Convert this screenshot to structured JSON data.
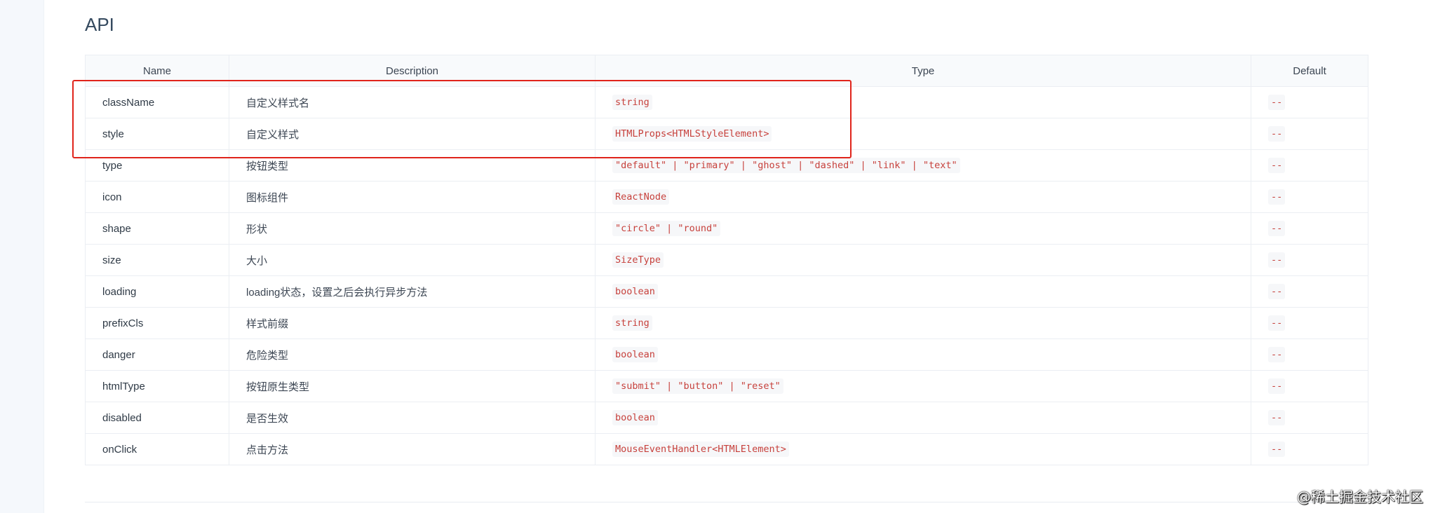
{
  "section": {
    "title": "API"
  },
  "table": {
    "headers": {
      "name": "Name",
      "description": "Description",
      "type": "Type",
      "default": "Default"
    },
    "rows": [
      {
        "name": "className",
        "description": "自定义样式名",
        "type": "string",
        "default": "--"
      },
      {
        "name": "style",
        "description": "自定义样式",
        "type": "HTMLProps<HTMLStyleElement>",
        "default": "--"
      },
      {
        "name": "type",
        "description": "按钮类型",
        "type": "\"default\" | \"primary\" | \"ghost\" | \"dashed\" | \"link\" | \"text\"",
        "default": "--"
      },
      {
        "name": "icon",
        "description": "图标组件",
        "type": "ReactNode",
        "default": "--"
      },
      {
        "name": "shape",
        "description": "形状",
        "type": "\"circle\" | \"round\"",
        "default": "--"
      },
      {
        "name": "size",
        "description": "大小",
        "type": "SizeType",
        "default": "--"
      },
      {
        "name": "loading",
        "description": "loading状态，设置之后会执行异步方法",
        "type": "boolean",
        "default": "--"
      },
      {
        "name": "prefixCls",
        "description": "样式前缀",
        "type": "string",
        "default": "--"
      },
      {
        "name": "danger",
        "description": "危险类型",
        "type": "boolean",
        "default": "--"
      },
      {
        "name": "htmlType",
        "description": "按钮原生类型",
        "type": "\"submit\" | \"button\" | \"reset\"",
        "default": "--"
      },
      {
        "name": "disabled",
        "description": "是否生效",
        "type": "boolean",
        "default": "--"
      },
      {
        "name": "onClick",
        "description": "点击方法",
        "type": "MouseEventHandler<HTMLElement>",
        "default": "--"
      }
    ]
  },
  "watermark": "@稀土掘金技术社区",
  "colors": {
    "code_text": "#c7413c",
    "highlight_border": "#e0241b",
    "header_bg": "#f8fafc"
  }
}
